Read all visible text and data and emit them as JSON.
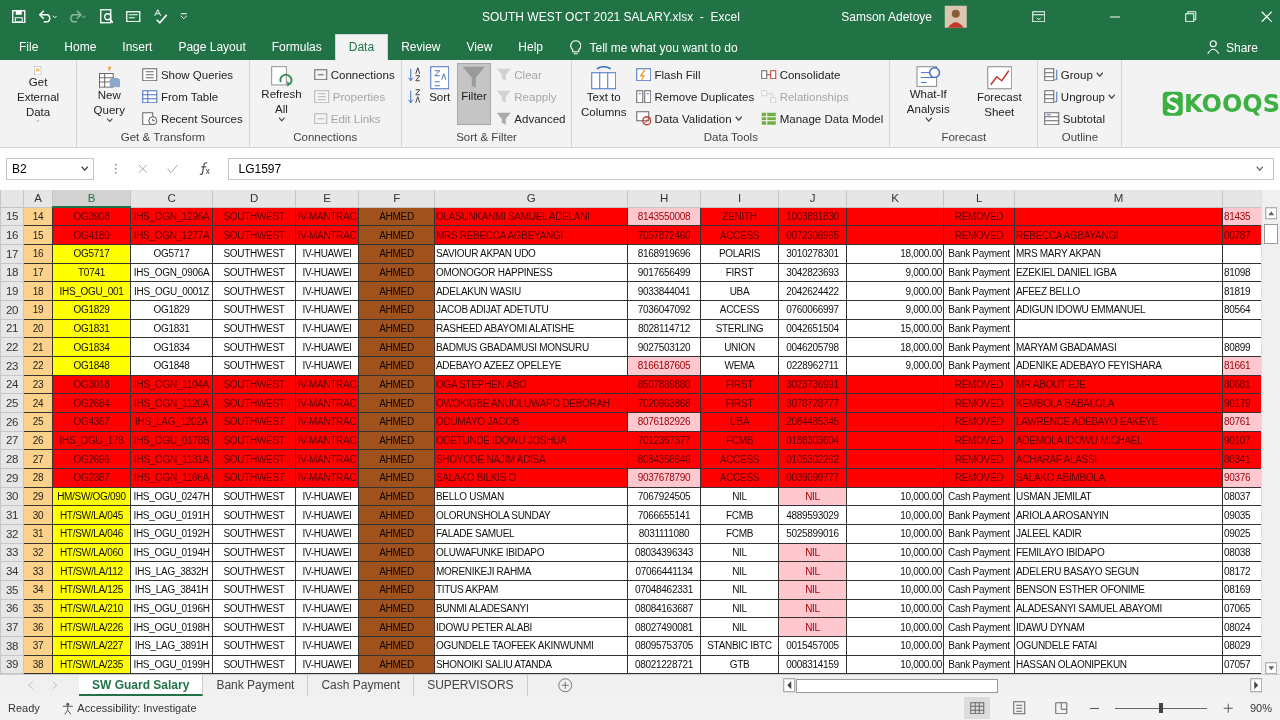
{
  "window": {
    "title": "SOUTH WEST OCT 2021 SALARY.xlsx  -  Excel",
    "user": "Samson Adetoye"
  },
  "menu_tabs": [
    {
      "label": "File",
      "selected": false
    },
    {
      "label": "Home",
      "selected": false
    },
    {
      "label": "Insert",
      "selected": false
    },
    {
      "label": "Page Layout",
      "selected": false
    },
    {
      "label": "Formulas",
      "selected": false
    },
    {
      "label": "Data",
      "selected": true
    },
    {
      "label": "Review",
      "selected": false
    },
    {
      "label": "View",
      "selected": false
    },
    {
      "label": "Help",
      "selected": false
    }
  ],
  "tell_me": {
    "placeholder": "Tell me what you want to do"
  },
  "share": "Share",
  "ribbon_groups": [
    {
      "buttons": [
        {
          "label": "Get External Data",
          "kind": "large",
          "dropdown": true
        }
      ]
    },
    {
      "label": "Get & Transform",
      "buttons": [
        {
          "label": "New Query",
          "kind": "large",
          "dropdown": true
        },
        {
          "label": "Show Queries",
          "kind": "small"
        },
        {
          "label": "From Table",
          "kind": "small"
        },
        {
          "label": "Recent Sources",
          "kind": "small"
        }
      ]
    },
    {
      "label": "Connections",
      "buttons": [
        {
          "label": "Refresh All",
          "kind": "large",
          "dropdown": true
        },
        {
          "label": "Connections",
          "kind": "small"
        },
        {
          "label": "Properties",
          "kind": "small",
          "disabled": true
        },
        {
          "label": "Edit Links",
          "kind": "small",
          "disabled": true
        }
      ]
    },
    {
      "label": "Sort & Filter",
      "buttons": [
        {
          "kind": "icon"
        },
        {
          "kind": "icon"
        },
        {
          "label": "Sort",
          "kind": "large"
        },
        {
          "label": "Filter",
          "kind": "large",
          "selected": true
        },
        {
          "label": "Clear",
          "kind": "small",
          "disabled": true
        },
        {
          "label": "Reapply",
          "kind": "small",
          "disabled": true
        },
        {
          "label": "Advanced",
          "kind": "small"
        }
      ]
    },
    {
      "label": "Data Tools",
      "buttons": [
        {
          "label": "Text to Columns",
          "kind": "large"
        },
        {
          "label": "Flash Fill",
          "kind": "small"
        },
        {
          "label": "Remove Duplicates",
          "kind": "small"
        },
        {
          "label": "Data Validation",
          "kind": "small",
          "dropdown": true
        },
        {
          "label": "Consolidate",
          "kind": "small"
        },
        {
          "label": "Relationships",
          "kind": "small",
          "disabled": true
        },
        {
          "label": "Manage Data Model",
          "kind": "small"
        }
      ]
    },
    {
      "label": "Forecast",
      "buttons": [
        {
          "label": "What-If Analysis",
          "kind": "large",
          "dropdown": true
        },
        {
          "label": "Forecast Sheet",
          "kind": "large"
        }
      ]
    },
    {
      "label": "Outline",
      "buttons": [
        {
          "label": "Group",
          "kind": "small",
          "dropdown": true
        },
        {
          "label": "Ungroup",
          "kind": "small",
          "dropdown": true
        },
        {
          "label": "Subtotal",
          "kind": "small"
        }
      ]
    }
  ],
  "logo": "KOOQS",
  "formula_bar": {
    "name_box": "B2",
    "value": "LG1597"
  },
  "columns": [
    {
      "label": "A",
      "selected": false
    },
    {
      "label": "B",
      "selected": true
    },
    {
      "label": "C",
      "selected": false
    },
    {
      "label": "D",
      "selected": false
    },
    {
      "label": "E",
      "selected": false
    },
    {
      "label": "F",
      "selected": false
    },
    {
      "label": "G",
      "selected": false
    },
    {
      "label": "H",
      "selected": false
    },
    {
      "label": "I",
      "selected": false
    },
    {
      "label": "J",
      "selected": false
    },
    {
      "label": "K",
      "selected": false
    },
    {
      "label": "L",
      "selected": false
    },
    {
      "label": "M",
      "selected": false
    }
  ],
  "rows": [
    {
      "row": "15",
      "removed": true,
      "phone_flagged": true,
      "account_flagged": false,
      "cells": [
        "14",
        "OG3908",
        "IHS_OGN_1296A",
        "SOUTHWEST",
        "IV-MANTRAC",
        "AHMED",
        "OLASUNKANMI SAMUEL ADELANI",
        "8143550008",
        "ZENITH",
        "1003881830",
        null,
        "REMOVED",
        null,
        "81435"
      ]
    },
    {
      "row": "16",
      "removed": true,
      "phone_flagged": false,
      "account_flagged": false,
      "cells": [
        "15",
        "OG4180",
        "IHS_OGN_1277A",
        "SOUTHWEST",
        "IV-MANTRAC",
        "AHMED",
        "MRS REBECCA AGBEYANGI",
        "7057872460",
        "ACCESS",
        "0072306965",
        null,
        "REMOVED",
        "REBECCA AGBAYANGI",
        "00787"
      ]
    },
    {
      "row": "17",
      "removed": false,
      "phone_flagged": false,
      "account_flagged": false,
      "cells": [
        "16",
        "OG5717",
        "OG5717",
        "SOUTHWEST",
        "IV-HUAWEI",
        "AHMED",
        "SAVIOUR AKPAN UDO",
        "8168919696",
        "POLARIS",
        "3010278301",
        "18,000.00",
        "Bank Payment",
        "MRS MARY AKPAN",
        null
      ]
    },
    {
      "row": "18",
      "removed": false,
      "phone_flagged": false,
      "account_flagged": false,
      "cells": [
        "17",
        "T0741",
        "IHS_OGN_0906A",
        "SOUTHWEST",
        "IV-HUAWEI",
        "AHMED",
        "OMONOGOR HAPPINESS",
        "9017656499",
        "FIRST",
        "3042823693",
        "9,000.00",
        "Bank Payment",
        "EZEKIEL DANIEL IGBA",
        "81098"
      ]
    },
    {
      "row": "19",
      "removed": false,
      "phone_flagged": false,
      "account_flagged": false,
      "cells": [
        "18",
        "IHS_OGU_001",
        "IHS_OGU_0001Z",
        "SOUTHWEST",
        "IV-HUAWEI",
        "AHMED",
        "ADELAKUN WASIU",
        "9033844041",
        "UBA",
        "2042624422",
        "9,000.00",
        "Bank Payment",
        "AFEEZ BELLO",
        "81819"
      ]
    },
    {
      "row": "20",
      "removed": false,
      "phone_flagged": false,
      "account_flagged": false,
      "cells": [
        "19",
        "OG1829",
        "OG1829",
        "SOUTHWEST",
        "IV-HUAWEI",
        "AHMED",
        "JACOB ADIJAT ADETUTU",
        "7036047092",
        "ACCESS",
        "0760066997",
        "9,000.00",
        "Bank Payment",
        "ADIGUN IDOWU EMMANUEL",
        "80564"
      ]
    },
    {
      "row": "21",
      "removed": false,
      "phone_flagged": false,
      "account_flagged": false,
      "cells": [
        "20",
        "OG1831",
        "OG1831",
        "SOUTHWEST",
        "IV-HUAWEI",
        "AHMED",
        "RASHEED ABAYOMI ALATISHE",
        "8028114712",
        "STERLING",
        "0042651504",
        "15,000.00",
        "Bank Payment",
        null,
        null
      ]
    },
    {
      "row": "22",
      "removed": false,
      "phone_flagged": false,
      "account_flagged": false,
      "cells": [
        "21",
        "OG1834",
        "OG1834",
        "SOUTHWEST",
        "IV-HUAWEI",
        "AHMED",
        "BADMUS GBADAMUSI MONSURU",
        "9027503120",
        "UNION",
        "0046205798",
        "18,000.00",
        "Bank Payment",
        "MARYAM GBADAMASI",
        "80899"
      ]
    },
    {
      "row": "23",
      "removed": false,
      "phone_flagged": true,
      "account_flagged": false,
      "cells": [
        "22",
        "OG1848",
        "OG1848",
        "SOUTHWEST",
        "IV-HUAWEI",
        "AHMED",
        "ADEBAYO AZEEZ OPELEYE",
        "8166187605",
        "WEMA",
        "0228962711",
        "9,000.00",
        "Bank Payment",
        "ADENIKE ADEBAYO FEYISHARA",
        "81661"
      ]
    },
    {
      "row": "24",
      "removed": true,
      "phone_flagged": false,
      "account_flagged": false,
      "cells": [
        "23",
        "OG3018",
        "IHS_OGN_1104A",
        "SOUTHWEST",
        "IV-MANTRAC",
        "AHMED",
        "OGA STEPHEN ABO",
        "8507889880",
        "FIRST",
        "3023736991",
        null,
        "REMOVED",
        "MR ABOUT EJE",
        "80681"
      ]
    },
    {
      "row": "25",
      "removed": true,
      "phone_flagged": false,
      "account_flagged": false,
      "cells": [
        "24",
        "OG2684",
        "IHS_OGN_1120A",
        "SOUTHWEST",
        "IV-MANTRAC",
        "AHMED",
        "OWOKIGBE ANUOLUWAPO DEBORAH",
        "7020963868",
        "FIRST",
        "3078728777",
        null,
        "REMOVED",
        "KEMBOLA BABALOLA",
        "90179"
      ]
    },
    {
      "row": "26",
      "removed": true,
      "phone_flagged": true,
      "account_flagged": false,
      "cells": [
        "25",
        "OG4367",
        "IHS_LAG_1202A",
        "SOUTHWEST",
        "IV-MANTRAC",
        "AHMED",
        "ODUMAYO JACOB",
        "8076182926",
        "UBA",
        "2084485345",
        null,
        "REMOVED",
        "LAWRENCE ADEBAYO EAKEYE",
        "80761"
      ]
    },
    {
      "row": "27",
      "removed": true,
      "phone_flagged": false,
      "account_flagged": false,
      "cells": [
        "26",
        "IHS_OGU_178",
        "IHS_OGU_0178B",
        "SOUTHWEST",
        "IV-MANTRAC",
        "AHMED",
        "ODETUNDE IDOWU JOSHUA",
        "7012367377",
        "FCMB",
        "0188303604",
        null,
        "REMOVED",
        "ADEMOLA IDOWU MICHAEL",
        "90107"
      ]
    },
    {
      "row": "28",
      "removed": true,
      "phone_flagged": false,
      "account_flagged": false,
      "cells": [
        "27",
        "OG2696",
        "IHS_OGN_1131A",
        "SOUTHWEST",
        "IV-MANTRAC",
        "AHMED",
        "SHOYODE NAJIM ADISA",
        "8084358646",
        "ACCESS",
        "0105302262",
        null,
        "REMOVED",
        "ACHARAF ALASSI",
        "80341"
      ]
    },
    {
      "row": "29",
      "removed": true,
      "phone_flagged": true,
      "account_flagged": false,
      "cells": [
        "28",
        "OG2387",
        "IHS_OGN_1166A",
        "SOUTHWEST",
        "IV-MANTRAC",
        "AHMED",
        "SALAKO BILKIS O",
        "9037678790",
        "ACCESS",
        "0039099777",
        null,
        "REMOVED",
        "SALAKO ABIMBOLA",
        "90376"
      ]
    },
    {
      "row": "30",
      "removed": false,
      "phone_flagged": false,
      "account_flagged": true,
      "cells": [
        "29",
        "HM/SW/OG/090",
        "IHS_OGU_0247H",
        "SOUTHWEST",
        "IV-HUAWEI",
        "AHMED",
        "BELLO USMAN",
        "7067924505",
        "NIL",
        "NIL",
        "10,000.00",
        "Cash Payment",
        "USMAN JEMILAT",
        "08037"
      ]
    },
    {
      "row": "31",
      "removed": false,
      "phone_flagged": false,
      "account_flagged": false,
      "cells": [
        "30",
        "HT/SW/LA/045",
        "IHS_OGU_0191H",
        "SOUTHWEST",
        "IV-HUAWEI",
        "AHMED",
        "OLORUNSHOLA SUNDAY",
        "7066655141",
        "FCMB",
        "4889593029",
        "10,000.00",
        "Bank Payment",
        "ARIOLA AROSANYIN",
        "09035"
      ]
    },
    {
      "row": "32",
      "removed": false,
      "phone_flagged": false,
      "account_flagged": false,
      "cells": [
        "31",
        "HT/SW/LA/046",
        "IHS_OGU_0192H",
        "SOUTHWEST",
        "IV-HUAWEI",
        "AHMED",
        "FALADE SAMUEL",
        "8031111080",
        "FCMB",
        "5025899016",
        "10,000.00",
        "Bank Payment",
        "JALEEL KADIR",
        "09025"
      ]
    },
    {
      "row": "33",
      "removed": false,
      "phone_flagged": false,
      "account_flagged": true,
      "cells": [
        "32",
        "HT/SW/LA/060",
        "IHS_OGU_0194H",
        "SOUTHWEST",
        "IV-HUAWEI",
        "AHMED",
        "OLUWAFUNKE IBIDAPO",
        "08034396343",
        "NIL",
        "NIL",
        "10,000.00",
        "Cash Payment",
        "FEMILAYO IBIDAPO",
        "08038"
      ]
    },
    {
      "row": "34",
      "removed": false,
      "phone_flagged": false,
      "account_flagged": true,
      "cells": [
        "33",
        "HT/SW/LA/112",
        "IHS_LAG_3832H",
        "SOUTHWEST",
        "IV-HUAWEI",
        "AHMED",
        "MORENIKEJI RAHMA",
        "07066441134",
        "NIL",
        "NIL",
        "10,000.00",
        "Cash Payment",
        "ADELERU BASAYO SEGUN",
        "08172"
      ]
    },
    {
      "row": "35",
      "removed": false,
      "phone_flagged": false,
      "account_flagged": true,
      "cells": [
        "34",
        "HT/SW/LA/125",
        "IHS_LAG_3841H",
        "SOUTHWEST",
        "IV-HUAWEI",
        "AHMED",
        "TITUS AKPAM",
        "07048462331",
        "NIL",
        "NIL",
        "10,000.00",
        "Cash Payment",
        "BENSON ESTHER OFONIME",
        "08169"
      ]
    },
    {
      "row": "36",
      "removed": false,
      "phone_flagged": false,
      "account_flagged": true,
      "cells": [
        "35",
        "HT/SW/LA/210",
        "IHS_OGU_0196H",
        "SOUTHWEST",
        "IV-HUAWEI",
        "AHMED",
        "BUNMI ALADESANYI",
        "08084163687",
        "NIL",
        "NIL",
        "10,000.00",
        "Cash Payment",
        "ALADESANYI SAMUEL ABAYOMI",
        "07065"
      ]
    },
    {
      "row": "37",
      "removed": false,
      "phone_flagged": false,
      "account_flagged": true,
      "cells": [
        "36",
        "HT/SW/LA/226",
        "IHS_OGU_0198H",
        "SOUTHWEST",
        "IV-HUAWEI",
        "AHMED",
        "IDOWU PETER ALABI",
        "08027490081",
        "NIL",
        "NIL",
        "10,000.00",
        "Cash Payment",
        "IDAWU DYNAM",
        "08024"
      ]
    },
    {
      "row": "38",
      "removed": false,
      "phone_flagged": false,
      "account_flagged": false,
      "cells": [
        "37",
        "HT/SW/LA/227",
        "IHS_LAG_3891H",
        "SOUTHWEST",
        "IV-HUAWEI",
        "AHMED",
        "OGUNDELE TAOFEEK AKINWUNMI",
        "08095753705",
        "STANBIC IBTC",
        "0015457005",
        "10,000.00",
        "Bank Payment",
        "OGUNDELE FATAI",
        "08029"
      ]
    },
    {
      "row": "39",
      "removed": false,
      "phone_flagged": false,
      "account_flagged": false,
      "cells": [
        "38",
        "HT/SW/LA/235",
        "IHS_OGU_0199H",
        "SOUTHWEST",
        "IV-HUAWEI",
        "AHMED",
        "SHONOIKI SALIU ATANDA",
        "08021228721",
        "GTB",
        "0008314159",
        "10,000.00",
        "Bank Payment",
        "HASSAN OLAONIPEKUN",
        "07057"
      ]
    }
  ],
  "sheet_tabs": [
    {
      "label": "SW Guard Salary",
      "selected": true
    },
    {
      "label": "Bank Payment",
      "selected": false
    },
    {
      "label": "Cash Payment",
      "selected": false
    },
    {
      "label": "SUPERVISORS",
      "selected": false
    }
  ],
  "status_bar": {
    "mode": "Ready",
    "accessibility": "Accessibility: Investigate",
    "zoom": "90%",
    "zoom_slider": {
      "level": 0.5
    }
  }
}
